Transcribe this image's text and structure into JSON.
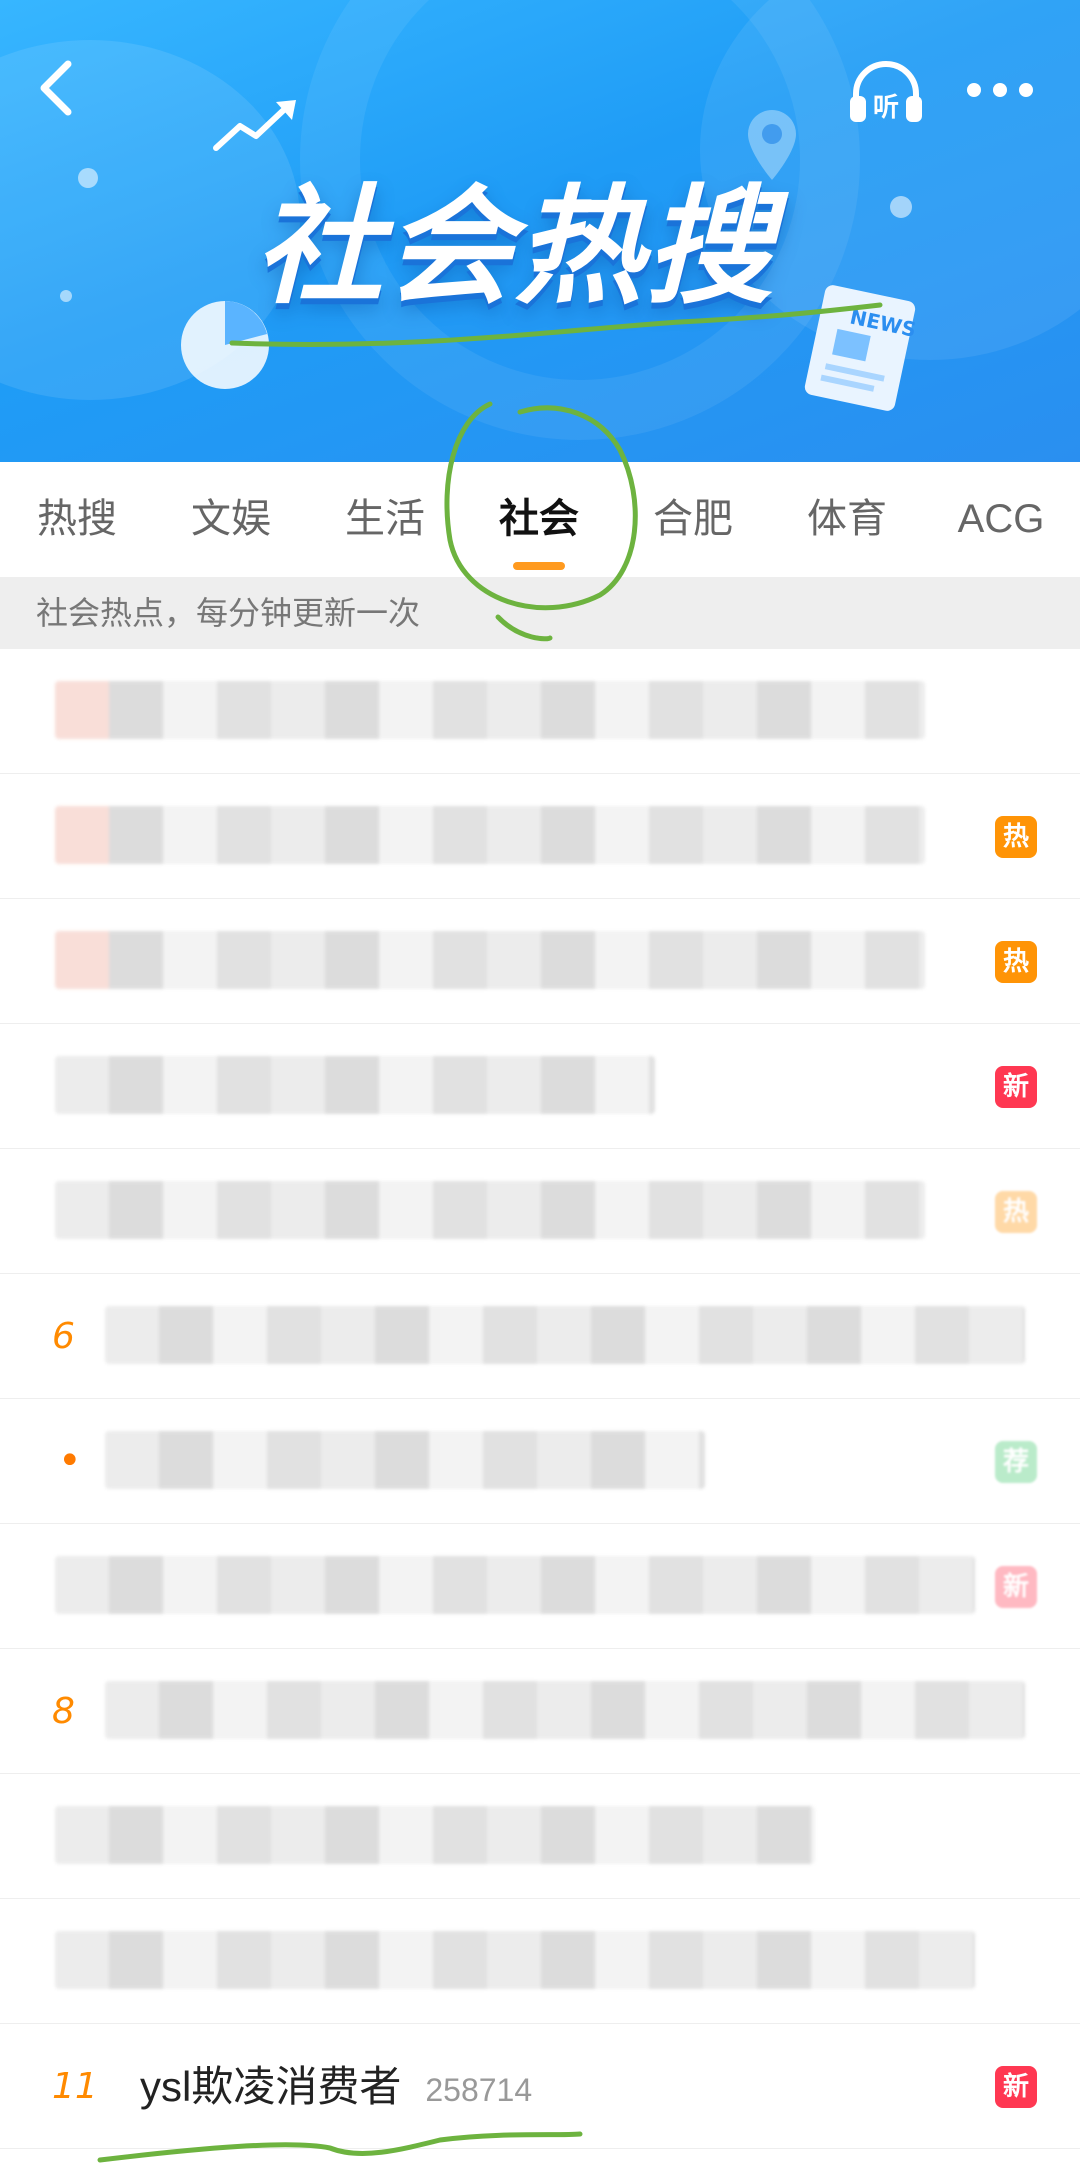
{
  "banner": {
    "title": "社会热搜",
    "news_label": "NEWS",
    "listen_label": "听"
  },
  "tabs": [
    {
      "label": "热搜",
      "active": false
    },
    {
      "label": "文娱",
      "active": false
    },
    {
      "label": "生活",
      "active": false
    },
    {
      "label": "社会",
      "active": true
    },
    {
      "label": "合肥",
      "active": false
    },
    {
      "label": "体育",
      "active": false
    },
    {
      "label": "ACG",
      "active": false
    }
  ],
  "subtitle": "社会热点，每分钟更新一次",
  "list": {
    "items": [
      {
        "rank": "",
        "blur_width": 870,
        "badge": ""
      },
      {
        "rank": "",
        "blur_width": 870,
        "badge": "热"
      },
      {
        "rank": "",
        "blur_width": 870,
        "badge": "热"
      },
      {
        "rank": "",
        "blur_width": 600,
        "badge": "新"
      },
      {
        "rank": "",
        "blur_width": 870,
        "badge": "热"
      },
      {
        "rank": "6",
        "blur_width": 920,
        "badge": ""
      },
      {
        "rank": "•",
        "blur_width": 600,
        "badge": "荐"
      },
      {
        "rank": "",
        "blur_width": 920,
        "badge": "新"
      },
      {
        "rank": "8",
        "blur_width": 920,
        "badge": ""
      },
      {
        "rank": "",
        "blur_width": 760,
        "badge": ""
      },
      {
        "rank": "",
        "blur_width": 920,
        "badge": ""
      },
      {
        "rank": "11",
        "title": "ysl欺凌消费者",
        "count": "258714",
        "badge": "新"
      }
    ]
  },
  "colors": {
    "accent": "#ff9a1f",
    "hot_badge": "#ff9406",
    "new_badge": "#ff3852",
    "rec_badge": "#3cc76a",
    "banner_blue": "#1f9cf6",
    "annotation_green": "#6db33f"
  }
}
